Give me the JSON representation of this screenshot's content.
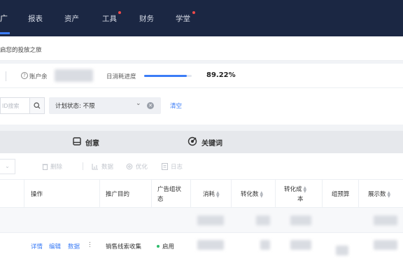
{
  "topnav": {
    "active_label": "广",
    "items": [
      {
        "label": "报表",
        "badge": false
      },
      {
        "label": "资产",
        "badge": false
      },
      {
        "label": "工具",
        "badge": true
      },
      {
        "label": "财务",
        "badge": false
      },
      {
        "label": "学堂",
        "badge": true
      }
    ]
  },
  "welcome": {
    "text": "启您的投放之旅"
  },
  "account": {
    "help_icon": "?",
    "label": "账户余",
    "progress_label": "日消耗进度",
    "progress_value": "89.22%",
    "progress_fraction": 0.8922
  },
  "filters": {
    "search_placeholder": "ID搜索",
    "search_icon": "search-icon",
    "status_label": "计划状态: 不限",
    "clear_label": "清空"
  },
  "tabs": [
    {
      "label": "创意",
      "icon": "creative-icon"
    },
    {
      "label": "关键词",
      "icon": "keyword-icon"
    }
  ],
  "toolbar": {
    "items": [
      {
        "label": "删除",
        "icon": "trash-icon"
      },
      {
        "label": "数据",
        "icon": "chart-icon"
      },
      {
        "label": "优化",
        "icon": "gear-icon"
      },
      {
        "label": "日志",
        "icon": "log-icon"
      }
    ]
  },
  "table": {
    "headers": {
      "actions": "操作",
      "purpose": "推广目的",
      "group_status_1": "广告组状",
      "group_status_2": "态",
      "spend": "消耗",
      "conversions": "转化数",
      "conv_cost_1": "转化成",
      "conv_cost_2": "本",
      "budget": "组预算",
      "impressions": "展示数"
    },
    "row": {
      "actions": [
        "详情",
        "编辑",
        "数据"
      ],
      "more": "⋮",
      "purpose": "销售线索收集",
      "status": "启用"
    }
  }
}
